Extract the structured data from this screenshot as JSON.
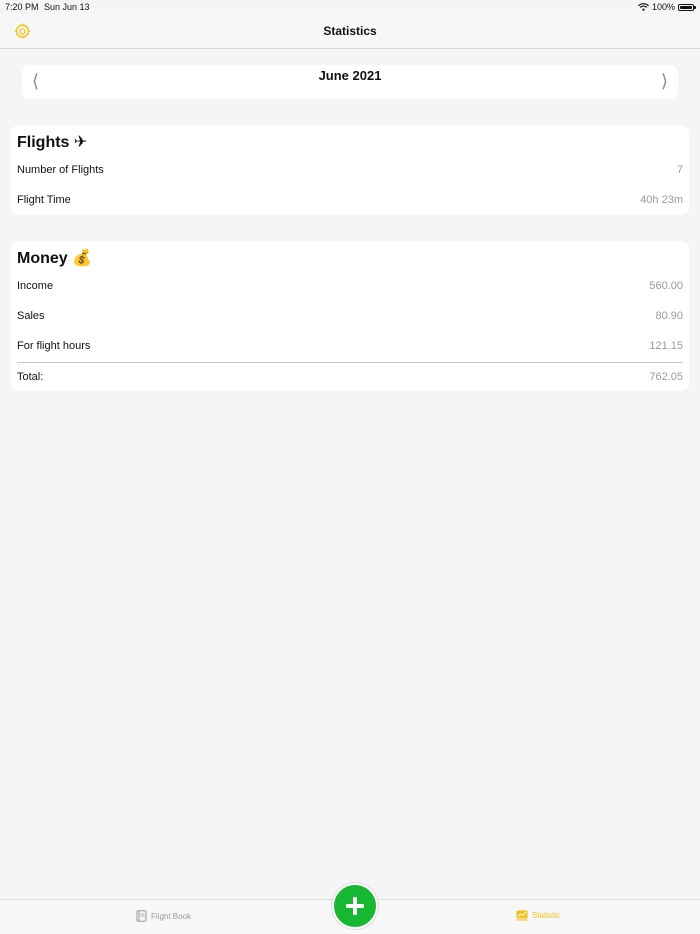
{
  "status_bar": {
    "time": "7:20 PM",
    "date": "Sun Jun 13",
    "battery": "100%"
  },
  "nav": {
    "title": "Statistics"
  },
  "month_picker": {
    "label": "June 2021",
    "prev": "⟨",
    "next": "⟩"
  },
  "flights": {
    "title": "Flights ✈",
    "rows": [
      {
        "label": "Number of Flights",
        "value": "7"
      },
      {
        "label": "Flight Time",
        "value": "40h 23m"
      }
    ]
  },
  "money": {
    "title": "Money 💰",
    "rows": [
      {
        "label": "Income",
        "value": "560.00"
      },
      {
        "label": "Sales",
        "value": "80.90"
      },
      {
        "label": "For flight hours",
        "value": "121.15"
      }
    ],
    "total": {
      "label": "Total:",
      "value": "762.05"
    }
  },
  "tabs": [
    {
      "label": "Flight Book",
      "icon": "book-icon",
      "active": false
    },
    {
      "label": "Statistic",
      "icon": "chart-icon",
      "active": true
    }
  ],
  "colors": {
    "accent": "#f2c21a",
    "add_button": "#17b732",
    "value_text": "#9a9a9a",
    "background": "#f5f5f5"
  }
}
